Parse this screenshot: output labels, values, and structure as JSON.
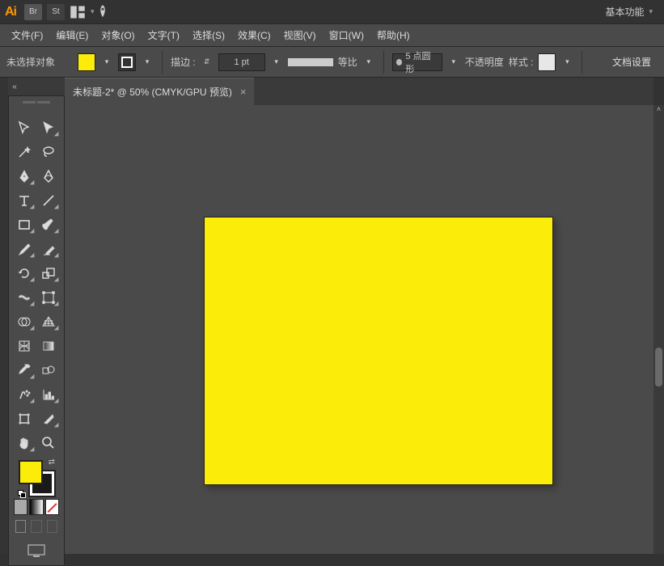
{
  "appbar": {
    "logo": "Ai",
    "bridge": "Br",
    "stock": "St",
    "workspace_label": "基本功能"
  },
  "menu": {
    "file": "文件(F)",
    "edit": "编辑(E)",
    "object": "对象(O)",
    "type": "文字(T)",
    "select": "选择(S)",
    "effect": "效果(C)",
    "view": "视图(V)",
    "window": "窗口(W)",
    "help": "帮助(H)"
  },
  "ctrl": {
    "no_selection": "未选择对象",
    "stroke_label": "描边 :",
    "stroke_weight": "1 pt",
    "uniform": "等比",
    "brush": "5 点圆形",
    "opacity": "不透明度",
    "style": "样式 :",
    "doc_setup": "文档设置",
    "fill_color": "#fcec0a"
  },
  "document": {
    "tab_title": "未标题-2* @ 50% (CMYK/GPU 预览)",
    "artboard_color": "#fcec0a"
  },
  "tools": {
    "fill_color": "#fcec0a",
    "stroke_color": "#000000"
  }
}
